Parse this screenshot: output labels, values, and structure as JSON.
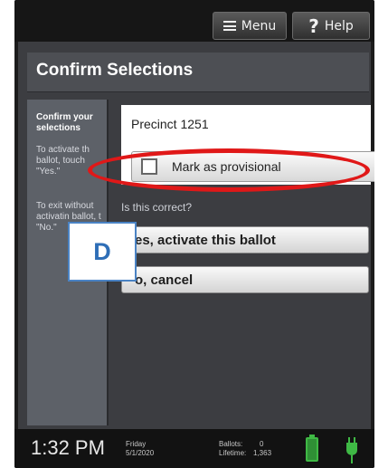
{
  "header": {
    "menu_label": "Menu",
    "help_label": "Help",
    "menu_icon": "menu-icon",
    "help_icon": "question-icon"
  },
  "page": {
    "title": "Confirm Selections"
  },
  "sidebar": {
    "heading": "Confirm your selections",
    "instruction_1": "To activate th ballot, touch \"Yes.\"",
    "instruction_2": "To exit without activatin ballot, t \"No.\""
  },
  "main": {
    "precinct": "Precinct 1251",
    "provisional_label": "Mark as provisional",
    "provisional_checked": false,
    "question": "Is this correct?",
    "yes_label": "es, activate this ballot",
    "no_label": "o, cancel"
  },
  "annotation": {
    "badge_letter": "D",
    "ellipse_color": "#e01818"
  },
  "status": {
    "time": "1:32 PM",
    "day": "Friday",
    "date": "5/1/2020",
    "ballots_label": "Ballots:",
    "ballots_value": "0",
    "lifetime_label": "Lifetime:",
    "lifetime_value": "1,363",
    "battery_icon": "battery-icon",
    "plug_icon": "power-plug-icon"
  }
}
